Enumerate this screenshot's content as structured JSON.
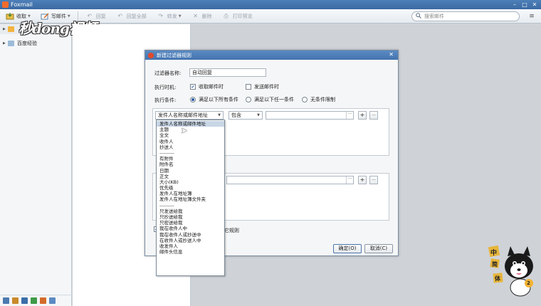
{
  "app": {
    "title": "Foxmail"
  },
  "toolbar": {
    "receive": "收取",
    "compose": "写邮件",
    "reply": "回复",
    "reply_all": "回复全部",
    "forward": "转发",
    "delete": "删除",
    "print_preview": "打印预览"
  },
  "search": {
    "placeholder": "搜索邮件"
  },
  "sidebar": {
    "items": [
      {
        "label": ""
      },
      {
        "label": "百度经验"
      }
    ]
  },
  "watermark": {
    "text": "秒dong视频"
  },
  "dialog": {
    "title": "新建过滤器规则",
    "name_label": "过滤器名称:",
    "name_value": "自动回复",
    "timing_label": "执行时机:",
    "timing_receive": "收取邮件时",
    "timing_send": "发送邮件时",
    "condition_label": "执行条件:",
    "cond_all": "满足以下所有条件",
    "cond_any": "满足以下任一条件",
    "cond_none": "无条件限制",
    "field_select": "发件人名称或邮件地址",
    "operator_select": "包含",
    "plus": "+",
    "minus": "−",
    "ellipsis": "···",
    "stop_other_rules": "它规则",
    "ok": "确定(O)",
    "cancel": "取消(C)"
  },
  "dropdown": {
    "items": [
      {
        "label": "发件人名称或邮件地址",
        "selected": true
      },
      {
        "label": "主题"
      },
      {
        "label": "全文"
      },
      {
        "label": "收件人"
      },
      {
        "label": "抄送人"
      },
      {
        "label": "----------",
        "sep": true
      },
      {
        "label": "有附件"
      },
      {
        "label": "附件名"
      },
      {
        "label": "日期"
      },
      {
        "label": "正文"
      },
      {
        "label": "大小(KB)"
      },
      {
        "label": "优先级"
      },
      {
        "label": "发件人在地址簿"
      },
      {
        "label": "发件人在地址簿文件夹"
      },
      {
        "label": "----------",
        "sep": true
      },
      {
        "label": "只发送给我"
      },
      {
        "label": "只抄送给我"
      },
      {
        "label": "只密送给我"
      },
      {
        "label": "我在收件人中"
      },
      {
        "label": "我在收件人或抄送中"
      },
      {
        "label": "在收件人或抄送人中"
      },
      {
        "label": "收发件人"
      },
      {
        "label": "邮件头信息"
      }
    ]
  },
  "mascot": {
    "badge": "2",
    "chars": [
      "中",
      "简",
      "体"
    ]
  },
  "colors": {
    "titlebar": "#4474b0",
    "accent": "#2a5da8",
    "selection": "#c8d6e6"
  }
}
